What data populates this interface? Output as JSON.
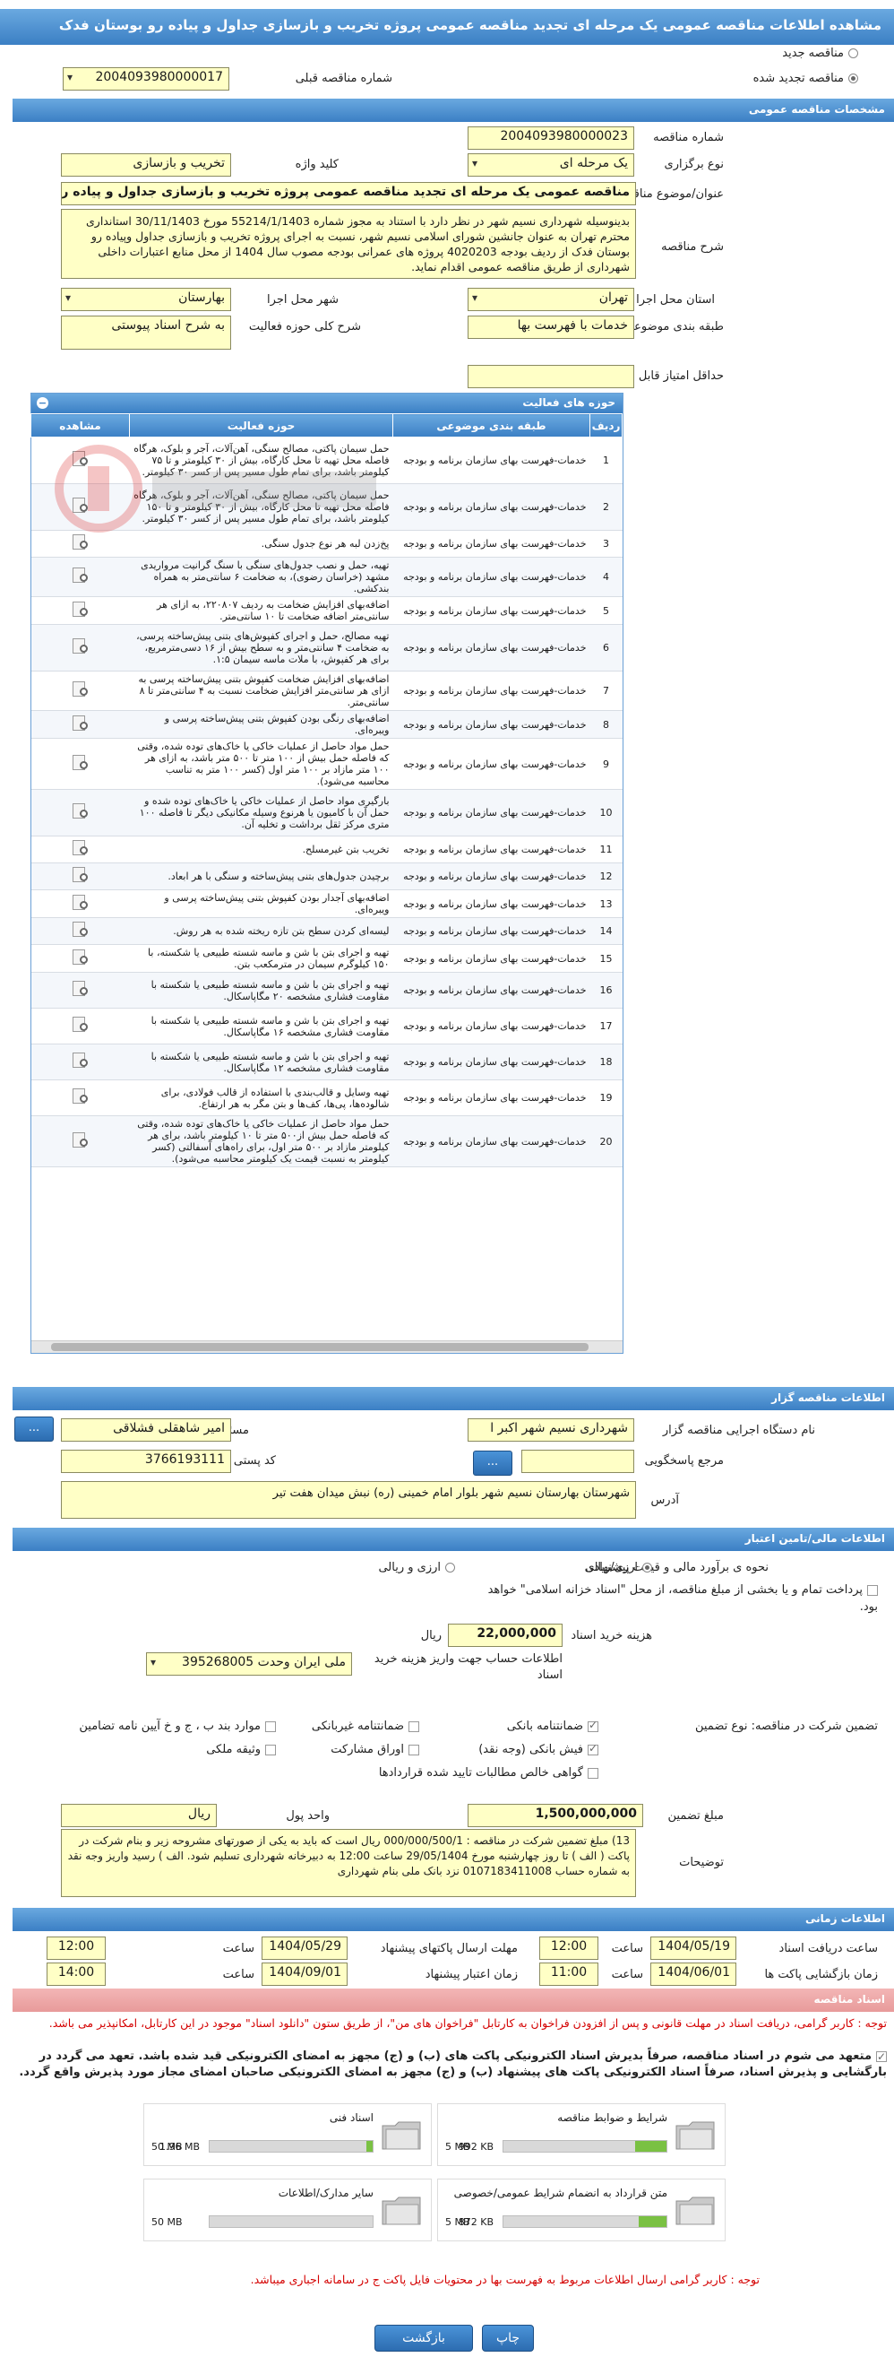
{
  "title": "مشاهده اطلاعات مناقصه عمومی یک مرحله ای تجدید مناقصه عمومی پروژه تخریب و بازسازی جداول و پیاده رو بوستان فدک",
  "top": {
    "new_tender": "مناقصه جدید",
    "renewed_tender": "مناقصه تجدید شده",
    "prev_number_label": "شماره مناقصه قبلی",
    "prev_number": "2004093980000017"
  },
  "general": {
    "header": "مشخصات مناقصه عمومی",
    "number_label": "شماره مناقصه",
    "number": "2004093980000023",
    "type_label": "نوع برگزاری",
    "type": "یک مرحله ای",
    "keyword_label": "کلید واژه",
    "keyword": "تخریب و بازسازی",
    "subject_label": "عنوان/موضوع مناقصه",
    "subject": "مناقصه عمومی یک مرحله ای تجدید مناقصه عمومی پروژه تخریب و بازسازی جداول و پیاده رو بو",
    "desc_label": "شرح مناقصه",
    "desc": "بدینوسیله شهرداری نسیم شهر در نظر دارد با استناد به مجوز شماره 55214/1/1403 مورخ 30/11/1403 استانداری محترم تهران به عنوان جانشین شورای اسلامی نسیم شهر، نسبت به اجرای پروژه تخریب و بازسازی جداول وپیاده رو بوستان فدک از ردیف بودجه 4020203 پروژه های عمرانی بودجه مصوب سال 1404 از محل منابع اعتبارات داخلی شهرداری از طریق مناقصه عمومی اقدام نماید.",
    "province_label": "استان محل اجرا",
    "province": "تهران",
    "city_label": "شهر محل اجرا",
    "city": "بهارستان",
    "category_label": "طبقه بندی موضوعی",
    "category": "خدمات با فهرست بها",
    "scope_label": "شرح کلی حوزه فعالیت",
    "scope": "به شرح اسناد پیوستی",
    "min_score_label": "حداقل امتیاز قابل قبول ارزیابی فنی/بازرگانی",
    "min_score": ""
  },
  "activity": {
    "header": "حوزه های فعالیت",
    "columns": [
      "ردیف",
      "طبقه بندی موضوعی",
      "حوزه فعالیت",
      "مشاهده"
    ],
    "rows": [
      {
        "n": "1",
        "cat": "خدمات-فهرست بهای سازمان برنامه و بودجه",
        "act": "حمل سیمان پاکتی، مصالح سنگی، آهن‌آلات، آجر و بلوک، هرگاه فاصله محل تهیه تا محل کارگاه، بیش از ۳۰ کیلومتر و تا ۷۵ کیلومتر باشد، برای تمام طول مسیر پس از کسر ۳۰ کیلومتر."
      },
      {
        "n": "2",
        "cat": "خدمات-فهرست بهای سازمان برنامه و بودجه",
        "act": "حمل سیمان پاکتی، مصالح سنگی، آهن‌آلات، آجر و بلوک، هرگاه فاصله محل تهیه تا محل کارگاه، بیش از ۳۰ کیلومتر و تا ۱۵۰ کیلومتر باشد، برای تمام طول مسیر پس از کسر ۳۰ کیلومتر."
      },
      {
        "n": "3",
        "cat": "خدمات-فهرست بهای سازمان برنامه و بودجه",
        "act": "پخ‌زدن لبه هر نوع جدول سنگی."
      },
      {
        "n": "4",
        "cat": "خدمات-فهرست بهای سازمان برنامه و بودجه",
        "act": "تهیه، حمل و نصب جدول‌های سنگی با سنگ گرانیت مرواریدی مشهد (خراسان رضوی)، به ضخامت ۶ سانتی‌متر به همراه بندکشی."
      },
      {
        "n": "5",
        "cat": "خدمات-فهرست بهای سازمان برنامه و بودجه",
        "act": "اضافه‌بهای افزایش ضخامت به ردیف ۲۲۰۸۰۷، به ازای هر سانتی‌متر اضافه ضخامت تا ۱۰ سانتی‌متر."
      },
      {
        "n": "6",
        "cat": "خدمات-فهرست بهای سازمان برنامه و بودجه",
        "act": "تهیه مصالح، حمل و اجرای کفپوش‌های بتنی پیش‌ساخته پرسی، به ضخامت ۴ سانتی‌متر و به سطح بیش از ۱۶ دسی‌مترمربع، برای هر کفپوش، با ملات ماسه سیمان ۱:۵."
      },
      {
        "n": "7",
        "cat": "خدمات-فهرست بهای سازمان برنامه و بودجه",
        "act": "اضافه‌بهای افزایش ضخامت کفپوش بتنی پیش‌ساخته پرسی به ازای هر سانتی‌متر افزایش ضخامت نسبت به ۴ سانتی‌متر تا ۸ سانتی‌متر."
      },
      {
        "n": "8",
        "cat": "خدمات-فهرست بهای سازمان برنامه و بودجه",
        "act": "اضافه‌بهای رنگی بودن کفپوش بتنی پیش‌ساخته پرسی و ویبره‌ای."
      },
      {
        "n": "9",
        "cat": "خدمات-فهرست بهای سازمان برنامه و بودجه",
        "act": "حمل مواد حاصل از عملیات خاکی یا خاک‌های توده شده، وقتی که فاصله حمل بیش از ۱۰۰ متر تا ۵۰۰ متر باشد، به ازای هر ۱۰۰ متر مازاد بر ۱۰۰ متر اول (کسر ۱۰۰ متر به تناسب محاسبه می‌شود)."
      },
      {
        "n": "10",
        "cat": "خدمات-فهرست بهای سازمان برنامه و بودجه",
        "act": "بارگیری مواد حاصل از عملیات خاکی یا خاک‌های توده شده و حمل آن با کامیون یا هرنوع وسیله مکانیکی دیگر تا فاصله ۱۰۰ متری مرکز ثقل برداشت و تخلیه آن."
      },
      {
        "n": "11",
        "cat": "خدمات-فهرست بهای سازمان برنامه و بودجه",
        "act": "تخریب بتن غیرمسلح."
      },
      {
        "n": "12",
        "cat": "خدمات-فهرست بهای سازمان برنامه و بودجه",
        "act": "برچیدن جدول‌های بتنی پیش‌ساخته و سنگی با هر ابعاد."
      },
      {
        "n": "13",
        "cat": "خدمات-فهرست بهای سازمان برنامه و بودجه",
        "act": "اضافه‌بهای آجدار بودن کفپوش بتنی پیش‌ساخته پرسی و ویبره‌ای."
      },
      {
        "n": "14",
        "cat": "خدمات-فهرست بهای سازمان برنامه و بودجه",
        "act": "لیسه‌ای کردن سطح بتن تازه ریخته شده به هر روش."
      },
      {
        "n": "15",
        "cat": "خدمات-فهرست بهای سازمان برنامه و بودجه",
        "act": "تهیه و اجرای بتن با شن و ماسه شسته طبیعی یا شکسته، با ۱۵۰ کیلوگرم سیمان در مترمکعب بتن."
      },
      {
        "n": "16",
        "cat": "خدمات-فهرست بهای سازمان برنامه و بودجه",
        "act": "تهیه و اجرای بتن با شن و ماسه شسته طبیعی یا شکسته با مقاومت فشاری مشخصه ۲۰ مگاپاسکال."
      },
      {
        "n": "17",
        "cat": "خدمات-فهرست بهای سازمان برنامه و بودجه",
        "act": "تهیه و اجرای بتن با شن و ماسه شسته طبیعی یا شکسته با مقاومت فشاری مشخصه ۱۶ مگاپاسکال."
      },
      {
        "n": "18",
        "cat": "خدمات-فهرست بهای سازمان برنامه و بودجه",
        "act": "تهیه و اجرای بتن با شن و ماسه شسته طبیعی یا شکسته با مقاومت فشاری مشخصه ۱۲ مگاپاسکال."
      },
      {
        "n": "19",
        "cat": "خدمات-فهرست بهای سازمان برنامه و بودجه",
        "act": "تهیه وسایل و قالب‌بندی با استفاده از قالب فولادی، برای شالوده‌ها، پی‌ها، کف‌ها و بتن مگر به هر ارتفاع."
      },
      {
        "n": "20",
        "cat": "خدمات-فهرست بهای سازمان برنامه و بودجه",
        "act": "حمل مواد حاصل از عملیات خاکی یا خاک‌های توده شده، وقتی که فاصله حمل بیش از۵۰۰ متر تا ۱۰ کیلومتر باشد، برای هر کیلومتر مازاد بر ۵۰۰ متر اول، برای راه‌های آسفالتی (کسر کیلومتر به نسبت قیمت یک کیلومتر محاسبه می‌شود)."
      }
    ]
  },
  "organizer": {
    "header": "اطلاعات مناقصه گزار",
    "org_label": "نام دستگاه اجرایی مناقصه گزار",
    "org": "شهرداری نسیم شهر اکبر ا",
    "officer_label": "مسئول ثبت مناقصه",
    "officer": "امیر شاهقلی فشلاقی",
    "ref_label": "مرجع پاسخگویی",
    "ref": "",
    "postal_label": "کد پستی",
    "postal": "3766193111",
    "address_label": "آدرس",
    "address": "شهرستان بهارستان نسیم شهر بلوار امام خمینی (ره) نبش میدان هفت تیر",
    "more": "..."
  },
  "finance": {
    "header": "اطلاعات مالی/تامین اعتبار",
    "eval_label": "نحوه ی برآورد مالی و قیمت پیشنهادی",
    "opt_rial": "ارزی/ریالی",
    "opt_currency": "ارزی و ریالی",
    "treasury_text": "پرداخت تمام و یا بخشی از مبلغ مناقصه، از محل \"اسناد خزانه اسلامی\" خواهد بود.",
    "doc_fee_label": "هزینه خرید اسناد",
    "doc_fee": "22,000,000",
    "doc_fee_unit": "ریال",
    "account_label": "اطلاعات حساب جهت واریز هزینه خرید اسناد",
    "account": "ملی ایران وحدت 395268005"
  },
  "guarantee": {
    "type_label": "تضمین شرکت در مناقصه:  نوع تضمین",
    "options": [
      {
        "label": "ضمانتنامه بانکی",
        "on": true
      },
      {
        "label": "ضمانتنامه غیربانکی",
        "on": false
      },
      {
        "label": "موارد بند ب ، ج و خ آیین نامه تضامین",
        "on": false
      },
      {
        "label": "فیش بانکی (وجه نقد)",
        "on": true
      },
      {
        "label": "اوراق مشارکت",
        "on": false
      },
      {
        "label": "وثیقه ملکی",
        "on": false
      },
      {
        "label": "گواهی خالص مطالبات تایید شده قراردادها",
        "on": false
      }
    ],
    "amount_label": "مبلغ تضمین",
    "amount": "1,500,000,000",
    "unit_label": "واحد پول",
    "unit": "ریال",
    "notes_label": "توضیحات",
    "notes": "13)   مبلغ تضمین شرکت در مناقصه : 000/000/500/1 ریال  است که باید به یکی از صورتهای مشروحه زیر و بنام شرکت در پاکت ( الف ) تا روز چهارشنبه مورخ 29/05/1404 ساعت 12:00  به دبیرخانه شهرداری تسلیم شود. الف ) رسید واریز وجه نقد به شماره حساب  0107183411008  نزد بانک ملی بنام شهرداری"
  },
  "schedule": {
    "header": "اطلاعات زمانی",
    "doc_start_label": "ساعت دریافت اسناد",
    "doc_start_date": "1404/05/19",
    "doc_start_time": "12:00",
    "submit_deadline_label": "مهلت ارسال پاکتهای پیشنهاد",
    "submit_deadline_date": "1404/05/29",
    "submit_deadline_time": "12:00",
    "open_label": "زمان بازگشایی پاکت ها",
    "open_date": "1404/06/01",
    "open_time": "11:00",
    "validity_label": "زمان اعتبار پیشنهاد",
    "validity_date": "1404/09/01",
    "validity_time": "14:00",
    "time_word": "ساعت"
  },
  "docs": {
    "header": "اسناد مناقصه",
    "notice": "توجه : کاربر گرامی، دریافت اسناد در مهلت قانونی و پس از افزودن فراخوان به کارتابل \"فراخوان های من\"، از طریق ستون \"دانلود اسناد\" موجود در این کارتابل، امکانپذیر می باشد.",
    "commitment": "متعهد می شوم در اسناد مناقصه، صرفاً بدیرش اسناد الکترونیکی پاکت های (ب) و (ج) مجهز به امضای الکترونیکی قید شده باشد. تعهد می گردد در بارگشایی و پذیرش اسناد، صرفاً اسناد الکترونیکی پاکت های پیشنهاد (ب) و (ج) مجهز به امضای الکترونیکی صاحبان امضای مجاز مورد پذیرش واقع گردد.",
    "files": [
      {
        "title": "شرایط و ضوابط مناقصه",
        "size": "992 KB",
        "max": "5 MB",
        "fill": 0.19
      },
      {
        "title": "اسناد فنی",
        "size": "1.96 MB",
        "max": "50 MB",
        "fill": 0.04
      },
      {
        "title": "متن قرارداد به انضمام شرایط عمومی/خصوصی",
        "size": "872 KB",
        "max": "5 MB",
        "fill": 0.17
      },
      {
        "title": "سایر مدارک/اطلاعات",
        "size": "",
        "max": "50 MB",
        "fill": 0
      }
    ],
    "footer_note": "توجه : کاربر گرامی ارسال اطلاعات مربوط به فهرست بها در محتویات فایل پاکت ج در سامانه اجباری میباشد."
  },
  "actions": {
    "print": "چاپ",
    "back": "بازگشت"
  }
}
